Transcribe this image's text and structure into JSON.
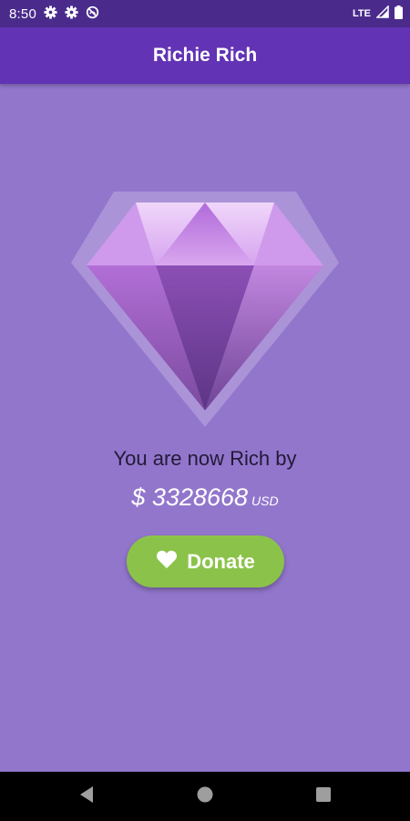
{
  "status_bar": {
    "time": "8:50",
    "network": "LTE",
    "left_icons": [
      "settings-gear-icon",
      "settings-gear-icon",
      "no-signal-icon"
    ],
    "right_icons": [
      "signal-icon",
      "battery-icon"
    ]
  },
  "app_bar": {
    "title": "Richie Rich",
    "color": "#6233b4"
  },
  "main": {
    "background_color": "#9276cc",
    "message": "You are now Rich by",
    "amount": "$ 3328668",
    "currency": "USD",
    "image_icon": "diamond-icon"
  },
  "donate_button": {
    "label": "Donate",
    "icon": "heart-icon",
    "color": "#8bc34a"
  },
  "nav_bar": {
    "buttons": [
      "back-icon",
      "home-icon",
      "recents-icon"
    ]
  }
}
